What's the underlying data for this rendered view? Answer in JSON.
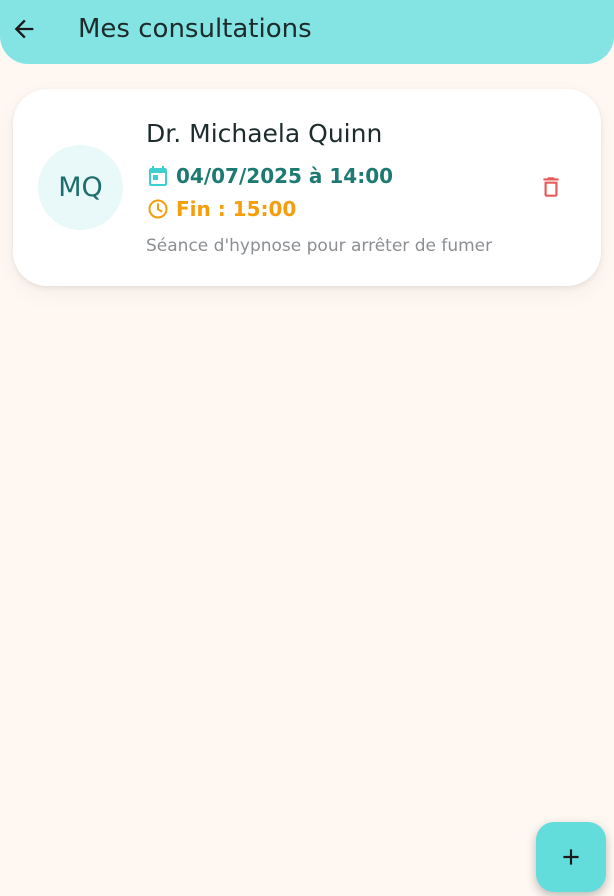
{
  "app_bar": {
    "title": "Mes consultations",
    "back_icon": "arrow-left-icon"
  },
  "consultation": {
    "initials": "MQ",
    "doctor_name": "Dr. Michaela Quinn",
    "date_time": "04/07/2025 à 14:00",
    "end_time": "Fin : 15:00",
    "description": "Séance d'hypnose pour arrêter de fumer",
    "icons": {
      "date": "calendar-icon",
      "end": "clock-icon",
      "delete": "trash-icon"
    }
  },
  "fab": {
    "icon": "plus-icon"
  },
  "colors": {
    "app_bar": "#84e4e3",
    "background": "#fff7f1",
    "accent_teal": "#1d7a73",
    "accent_orange": "#f59e0b",
    "delete_red": "#e85b5b",
    "fab": "#63dcdc"
  }
}
